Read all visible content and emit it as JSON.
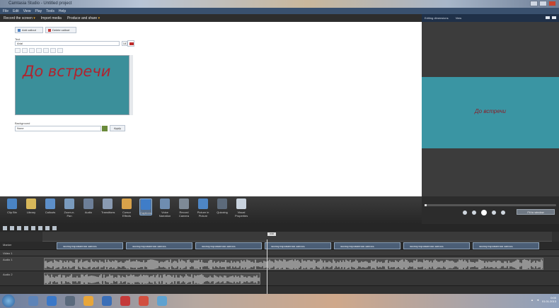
{
  "window": {
    "title": "Camtasia Studio - Untitled project"
  },
  "menu": [
    "File",
    "Edit",
    "View",
    "Play",
    "Tools",
    "Help"
  ],
  "commandbar": [
    {
      "label": "Record the screen",
      "accent": "▾"
    },
    {
      "label": "Import media",
      "accent": ""
    },
    {
      "label": "Produce and share",
      "accent": "▾"
    }
  ],
  "callouts_panel": {
    "add_button": "Add callout",
    "delete_button": "Delete callout",
    "font_label": "Text",
    "font_value": "Arial",
    "font_size": "18",
    "callout_text": "До встречи",
    "background_label": "Background",
    "background_option": "None",
    "background_button": "Apply"
  },
  "preview": {
    "tab1": "Editing dimensions",
    "tab2": "View",
    "canvas_text": "До встречи"
  },
  "toolbar": [
    {
      "name": "clip-bin",
      "label": "Clip Bin",
      "color": "#4a84c4"
    },
    {
      "name": "library",
      "label": "Library",
      "color": "#d8b85a"
    },
    {
      "name": "callouts",
      "label": "Callouts",
      "color": "#5d8fc9"
    },
    {
      "name": "zoom-n-pan",
      "label": "Zoom-n-Pan",
      "color": "#7a9bbe"
    },
    {
      "name": "audio",
      "label": "Audio",
      "color": "#6d7f98"
    },
    {
      "name": "transitions",
      "label": "Transitions",
      "color": "#8a9bb2"
    },
    {
      "name": "cursor-effects",
      "label": "Cursor Effects",
      "color": "#d8a24a"
    },
    {
      "name": "captions",
      "label": "Captions",
      "color": "#3f7dc8"
    },
    {
      "name": "voice-narration",
      "label": "Voice Narration",
      "color": "#6f8db0"
    },
    {
      "name": "record-camera",
      "label": "Record Camera",
      "color": "#7e8a96"
    },
    {
      "name": "picture-in-picture",
      "label": "Picture in Picture",
      "color": "#4e86c5"
    },
    {
      "name": "quizzing",
      "label": "Quizzing",
      "color": "#5c6a7a"
    },
    {
      "name": "visual-properties",
      "label": "Visual Properties",
      "color": "#c9d3de"
    }
  ],
  "player": {
    "size_button": "Fit to window"
  },
  "timeline": {
    "playhead_label": "0:00",
    "tracks": [
      {
        "label": "Marker"
      },
      {
        "label": "Video 1"
      },
      {
        "label": "Audio 1"
      },
      {
        "label": "Audio 2"
      }
    ],
    "clip_text": "экспортированная запись"
  },
  "taskbar": {
    "time": "0:00",
    "date": "01.01.2013"
  }
}
